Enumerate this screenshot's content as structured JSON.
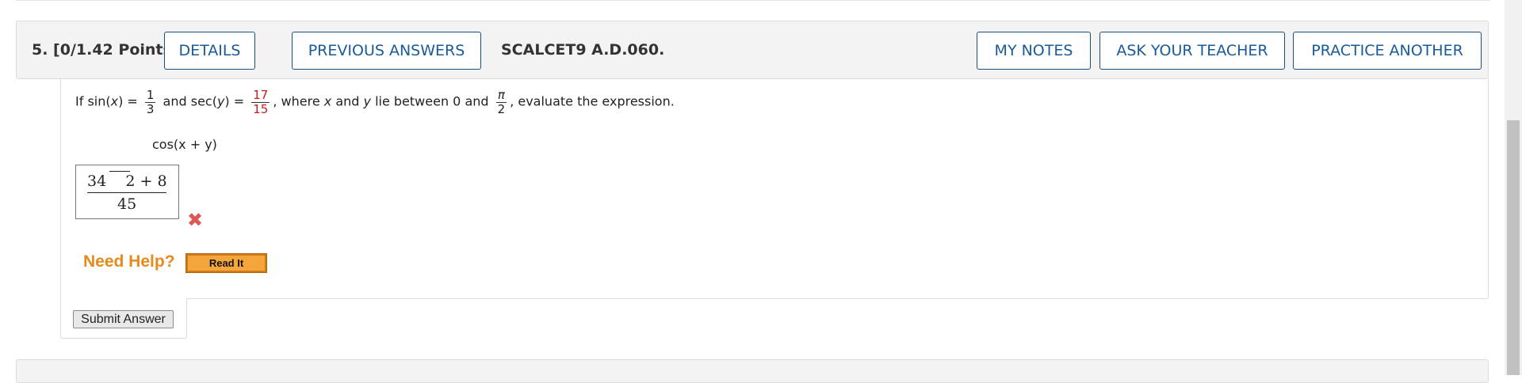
{
  "question": {
    "points_label": "5.  [0/1.42 Points]",
    "code": "SCALCET9 A.D.060."
  },
  "buttons": {
    "details": "DETAILS",
    "previous_answers": "PREVIOUS ANSWERS",
    "my_notes": "MY NOTES",
    "ask_teacher": "ASK YOUR TEACHER",
    "practice_another": "PRACTICE ANOTHER"
  },
  "prompt": {
    "if": "If sin(",
    "x1": "x",
    "eq1": ") =",
    "sin_num": "1",
    "sin_den": "3",
    "and_sec": "and sec(",
    "y1": "y",
    "eq2": ") =",
    "sec_num": "17",
    "sec_den": "15",
    "where": ", where",
    "x2": "x",
    "and": "and",
    "y2": "y",
    "lie": "lie between 0 and",
    "pi": "π",
    "two": "2",
    "evaluate": ", evaluate the expression."
  },
  "expression": {
    "text": "cos(x + y)"
  },
  "answer": {
    "numerator_a": "34",
    "numerator_b": "2 + 8",
    "denominator": "45",
    "status": "incorrect"
  },
  "help": {
    "label": "Need Help?",
    "read_it": "Read It"
  },
  "submit": {
    "label": "Submit Answer"
  },
  "colors": {
    "button_text": "#1a5a99",
    "red_value": "#cc1a1a",
    "help_orange": "#e8891c",
    "wrong_mark": "#e05555"
  },
  "icons": {
    "wrong": "x-mark-icon"
  }
}
